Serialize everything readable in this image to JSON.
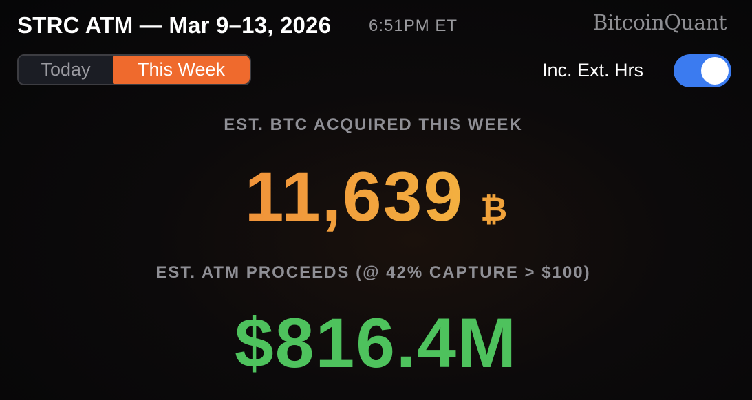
{
  "header": {
    "title": "STRC ATM — Mar 9–13, 2026",
    "time": "6:51PM ET",
    "brand": "BitcoinQuant"
  },
  "period_selector": {
    "options": [
      "Today",
      "This Week"
    ],
    "selected": "This Week"
  },
  "extended_hours": {
    "label": "Inc. Ext. Hrs",
    "enabled": true
  },
  "btc_section": {
    "label": "EST. BTC ACQUIRED THIS WEEK",
    "value": "11,639",
    "unit": "₿"
  },
  "atm_section": {
    "label": "EST. ATM PROCEEDS (@ 42% CAPTURE > $100)",
    "value": "$816.4M"
  },
  "colors": {
    "accent_orange": "#ef6a2d",
    "btc_gold": "#f0a23b",
    "proceeds_green": "#4ec25d",
    "toggle_blue": "#3b7bf0"
  }
}
